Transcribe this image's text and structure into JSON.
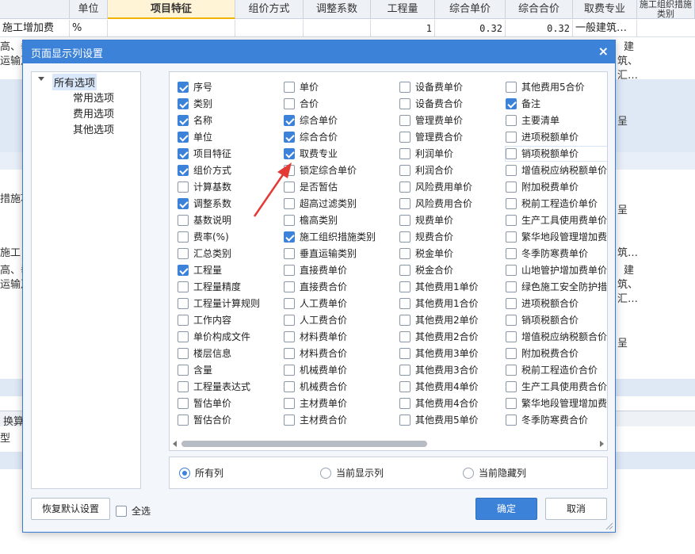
{
  "grid": {
    "headers": [
      "单位",
      "项目特征",
      "组价方式",
      "调整系数",
      "工程量",
      "综合单价",
      "综合合价",
      "取费专业",
      "施工组织措施类别"
    ],
    "row1": {
      "name": "施工增加费",
      "unit": "%",
      "quantity": "1",
      "unit_price": "0.32",
      "total_price": "0.32",
      "fee_major": "一般建筑…"
    },
    "left_fragments": [
      "高、垂",
      "运输及",
      "措施项",
      "施工",
      "高、垂",
      "运输及",
      "换算",
      "型"
    ],
    "right_fragments": [
      "建",
      "筑、",
      "高、",
      "汇…",
      "呈",
      "呈",
      "筑…",
      "建",
      "筑、",
      "汇…",
      "呈"
    ]
  },
  "dialog": {
    "title": "页面显示列设置",
    "close_icon": "×",
    "tree": {
      "root": "所有选项",
      "children": [
        "常用选项",
        "费用选项",
        "其他选项"
      ]
    },
    "columns": [
      [
        {
          "label": "序号",
          "checked": true
        },
        {
          "label": "类别",
          "checked": true
        },
        {
          "label": "名称",
          "checked": true
        },
        {
          "label": "单位",
          "checked": true
        },
        {
          "label": "项目特征",
          "checked": true
        },
        {
          "label": "组价方式",
          "checked": true
        },
        {
          "label": "计算基数",
          "checked": false
        },
        {
          "label": "调整系数",
          "checked": true
        },
        {
          "label": "基数说明",
          "checked": false
        },
        {
          "label": "费率(%)",
          "checked": false
        },
        {
          "label": "汇总类别",
          "checked": false
        },
        {
          "label": "工程量",
          "checked": true
        },
        {
          "label": "工程量精度",
          "checked": false
        },
        {
          "label": "工程量计算规则",
          "checked": false
        },
        {
          "label": "工作内容",
          "checked": false
        },
        {
          "label": "单价构成文件",
          "checked": false
        },
        {
          "label": "楼层信息",
          "checked": false
        },
        {
          "label": "含量",
          "checked": false
        },
        {
          "label": "工程量表达式",
          "checked": false
        },
        {
          "label": "暂估单价",
          "checked": false
        },
        {
          "label": "暂估合价",
          "checked": false
        }
      ],
      [
        {
          "label": "单价",
          "checked": false
        },
        {
          "label": "合价",
          "checked": false
        },
        {
          "label": "综合单价",
          "checked": true
        },
        {
          "label": "综合合价",
          "checked": true
        },
        {
          "label": "取费专业",
          "checked": true
        },
        {
          "label": "锁定综合单价",
          "checked": false
        },
        {
          "label": "是否暂估",
          "checked": false
        },
        {
          "label": "超高过滤类别",
          "checked": false
        },
        {
          "label": "檐高类别",
          "checked": false
        },
        {
          "label": "施工组织措施类别",
          "checked": true
        },
        {
          "label": "垂直运输类别",
          "checked": false
        },
        {
          "label": "直接费单价",
          "checked": false
        },
        {
          "label": "直接费合价",
          "checked": false
        },
        {
          "label": "人工费单价",
          "checked": false
        },
        {
          "label": "人工费合价",
          "checked": false
        },
        {
          "label": "材料费单价",
          "checked": false
        },
        {
          "label": "材料费合价",
          "checked": false
        },
        {
          "label": "机械费单价",
          "checked": false
        },
        {
          "label": "机械费合价",
          "checked": false
        },
        {
          "label": "主材费单价",
          "checked": false
        },
        {
          "label": "主材费合价",
          "checked": false
        }
      ],
      [
        {
          "label": "设备费单价",
          "checked": false
        },
        {
          "label": "设备费合价",
          "checked": false
        },
        {
          "label": "管理费单价",
          "checked": false
        },
        {
          "label": "管理费合价",
          "checked": false
        },
        {
          "label": "利润单价",
          "checked": false
        },
        {
          "label": "利润合价",
          "checked": false
        },
        {
          "label": "风险费用单价",
          "checked": false
        },
        {
          "label": "风险费用合价",
          "checked": false
        },
        {
          "label": "规费单价",
          "checked": false
        },
        {
          "label": "规费合价",
          "checked": false
        },
        {
          "label": "税金单价",
          "checked": false
        },
        {
          "label": "税金合价",
          "checked": false
        },
        {
          "label": "其他费用1单价",
          "checked": false
        },
        {
          "label": "其他费用1合价",
          "checked": false
        },
        {
          "label": "其他费用2单价",
          "checked": false
        },
        {
          "label": "其他费用2合价",
          "checked": false
        },
        {
          "label": "其他费用3单价",
          "checked": false
        },
        {
          "label": "其他费用3合价",
          "checked": false
        },
        {
          "label": "其他费用4单价",
          "checked": false
        },
        {
          "label": "其他费用4合价",
          "checked": false
        },
        {
          "label": "其他费用5单价",
          "checked": false
        }
      ],
      [
        {
          "label": "其他费用5合价",
          "checked": false
        },
        {
          "label": "备注",
          "checked": true
        },
        {
          "label": "主要清单",
          "checked": false
        },
        {
          "label": "进项税额单价",
          "checked": false
        },
        {
          "label": "销项税额单价",
          "checked": false
        },
        {
          "label": "增值税应纳税额单价",
          "checked": false
        },
        {
          "label": "附加税费单价",
          "checked": false
        },
        {
          "label": "税前工程造价单价",
          "checked": false
        },
        {
          "label": "生产工具使用费单价",
          "checked": false
        },
        {
          "label": "繁华地段管理增加费单价",
          "checked": false
        },
        {
          "label": "冬季防寒费单价",
          "checked": false
        },
        {
          "label": "山地管护增加费单价",
          "checked": false
        },
        {
          "label": "绿色施工安全防护措施费单价",
          "checked": false
        },
        {
          "label": "进项税额合价",
          "checked": false
        },
        {
          "label": "销项税额合价",
          "checked": false
        },
        {
          "label": "增值税应纳税额合价",
          "checked": false
        },
        {
          "label": "附加税费合价",
          "checked": false
        },
        {
          "label": "税前工程造价合价",
          "checked": false
        },
        {
          "label": "生产工具使用费合价",
          "checked": false
        },
        {
          "label": "繁华地段管理增加费合价",
          "checked": false
        },
        {
          "label": "冬季防寒费合价",
          "checked": false
        }
      ]
    ],
    "filter": {
      "options": [
        "所有列",
        "当前显示列",
        "当前隐藏列"
      ],
      "selected": "所有列"
    },
    "restore_label": "恢复默认设置",
    "select_all_label": "全选",
    "select_all_checked": false,
    "ok_label": "确定",
    "cancel_label": "取消",
    "accent_color": "#3d82d9",
    "annotation_color": "#e53935"
  }
}
